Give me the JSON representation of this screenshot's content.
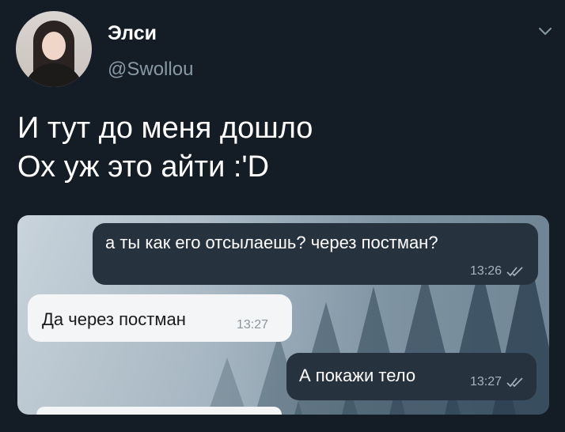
{
  "user": {
    "display_name": "Элси",
    "handle": "@Swollou"
  },
  "tweet": {
    "lines": [
      "И тут до меня дошло",
      "Ох уж это айти :'D"
    ]
  },
  "icons": {
    "menu": "chevron-down-icon",
    "read_receipt": "double-check-icon"
  },
  "chat": {
    "messages": [
      {
        "direction": "outgoing",
        "text": "а ты как его отсылаешь? через постман?",
        "time": "13:26",
        "read": true
      },
      {
        "direction": "incoming",
        "text": "Да через постман",
        "time": "13:27"
      },
      {
        "direction": "outgoing",
        "text": "А покажи тело",
        "time": "13:27",
        "read": true
      }
    ]
  },
  "colors": {
    "background": "#141d26",
    "handle": "#8899a6",
    "outgoing_bubble": "#27323f",
    "incoming_bubble": "#f3f5f7"
  }
}
